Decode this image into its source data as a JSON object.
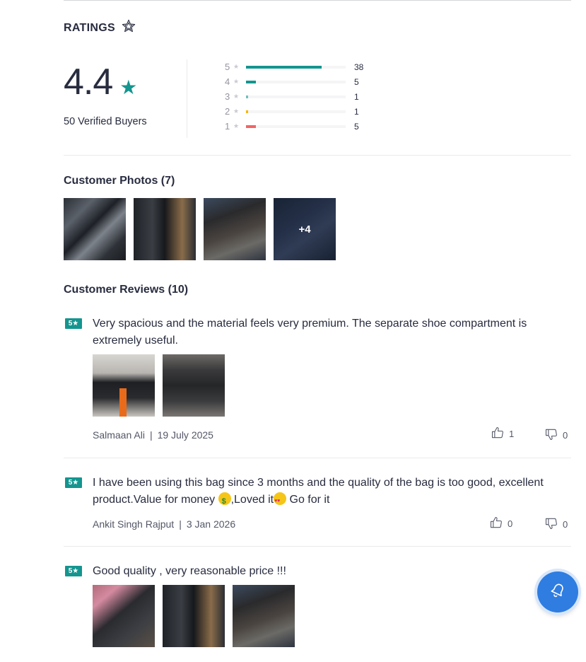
{
  "ratings": {
    "title": "RATINGS",
    "average": "4.4",
    "buyers": "50 Verified Buyers",
    "histogram": [
      {
        "level": "5",
        "count": "38",
        "fraction": 0.76,
        "color": "#14958f"
      },
      {
        "level": "4",
        "count": "5",
        "fraction": 0.1,
        "color": "#14958f"
      },
      {
        "level": "3",
        "count": "1",
        "fraction": 0.02,
        "color": "#72bfbc"
      },
      {
        "level": "2",
        "count": "1",
        "fraction": 0.02,
        "color": "#fcb301"
      },
      {
        "level": "1",
        "count": "5",
        "fraction": 0.1,
        "color": "#f16565"
      }
    ]
  },
  "photos": {
    "title": "Customer Photos (7)",
    "more_label": "+4"
  },
  "reviews": {
    "title": "Customer Reviews (10)",
    "items": [
      {
        "rating_badge": "5★",
        "text": "Very spacious and the material feels very premium. The separate shoe compartment is extremely useful.",
        "author": "Salmaan Ali",
        "date": "19 July 2025",
        "likes": "1",
        "dislikes": "0"
      },
      {
        "rating_badge": "5★",
        "text_part1": "I have been using this bag since 3 months and the quality of the bag is too good, excellent product.Value for money ",
        "text_part2": ",Loved it",
        "text_part3": " Go for it",
        "author": "Ankit Singh Rajput",
        "date": "3 Jan 2026",
        "likes": "0",
        "dislikes": "0"
      },
      {
        "rating_badge": "5★",
        "text": "Good quality , very reasonable price !!!"
      }
    ]
  },
  "separator": "|",
  "accent_color": "#14958f",
  "fab_color": "#2f7de1"
}
